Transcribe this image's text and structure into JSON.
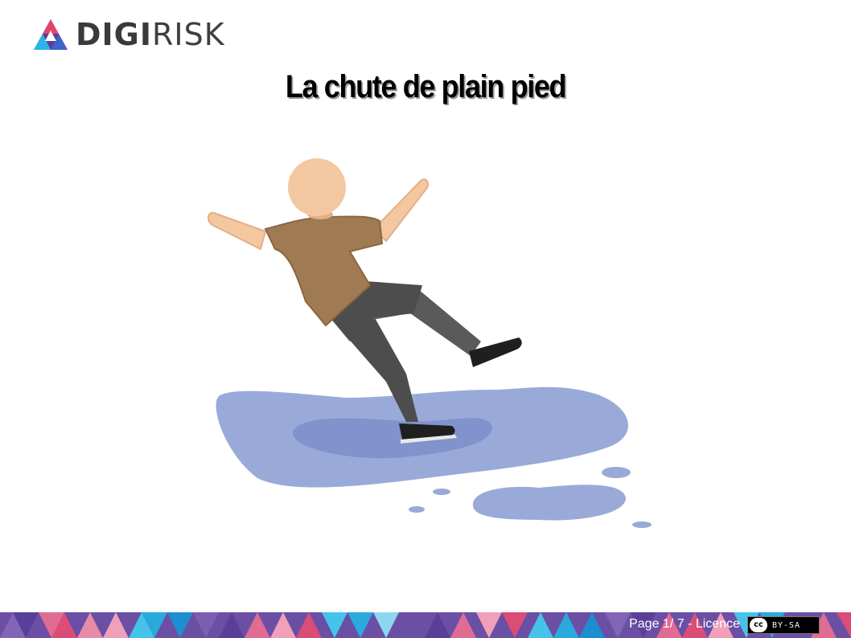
{
  "logo": {
    "bold_text": "DIGI",
    "light_text": "RISK"
  },
  "title": "La chute de plain pied",
  "footer": {
    "page_prefix": "Page ",
    "page_current": "1",
    "page_separator": "/ ",
    "page_total": "7",
    "licence_text": " - Licence",
    "badge_cc": "cc",
    "badge_text": "BY-SA"
  },
  "colors": {
    "skin": "#f3c7a0",
    "shirt": "#a07a52",
    "pants": "#4d4d4d",
    "puddle_light": "#9aaad8",
    "puddle_dark": "#8093cc",
    "shoe": "#1f1f1f"
  },
  "icons": {
    "logo": "triangle-logo-icon",
    "licence": "cc-by-sa-icon"
  }
}
